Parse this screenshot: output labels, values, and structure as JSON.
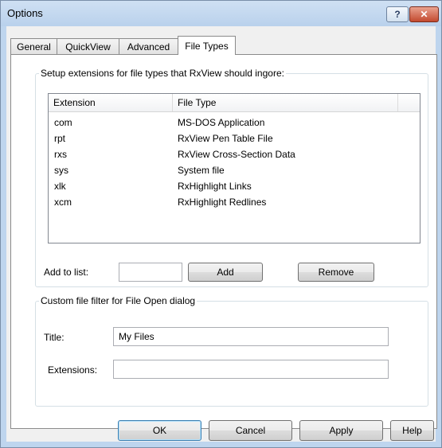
{
  "window": {
    "title": "Options"
  },
  "tabs": [
    {
      "label": "General"
    },
    {
      "label": "QuickView"
    },
    {
      "label": "Advanced"
    },
    {
      "label": "File Types"
    }
  ],
  "ignore_group": {
    "legend": "Setup extensions for file types that RxView should ingore:",
    "columns": [
      "Extension",
      "File Type"
    ],
    "rows": [
      {
        "ext": "com",
        "type": "MS-DOS Application"
      },
      {
        "ext": "rpt",
        "type": "RxView Pen Table File"
      },
      {
        "ext": "rxs",
        "type": "RxView Cross-Section Data"
      },
      {
        "ext": "sys",
        "type": "System file"
      },
      {
        "ext": "xlk",
        "type": "RxHighlight Links"
      },
      {
        "ext": "xcm",
        "type": "RxHighlight Redlines"
      }
    ],
    "add_label": "Add to list:",
    "add_value": "",
    "add_button": "Add",
    "remove_button": "Remove"
  },
  "filter_group": {
    "legend": "Custom file filter for File Open dialog",
    "title_label": "Title:",
    "title_value": "My Files",
    "extensions_label": "Extensions:",
    "extensions_value": ""
  },
  "buttons": {
    "ok": "OK",
    "cancel": "Cancel",
    "apply": "Apply",
    "help": "Help"
  }
}
